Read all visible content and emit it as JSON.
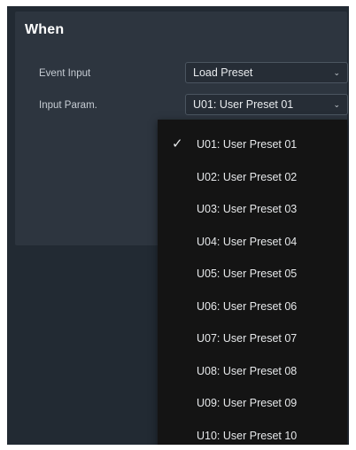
{
  "panel": {
    "title": "When"
  },
  "rows": [
    {
      "label": "Event Input",
      "value": "Load Preset"
    },
    {
      "label": "Input Param.",
      "value": "U01: User Preset 01"
    }
  ],
  "chevron_icon": "chevron-down",
  "dropdown": {
    "selected_index": 0,
    "check_icon": "checkmark",
    "items": [
      "U01: User Preset 01",
      "U02: User Preset 02",
      "U03: User Preset 03",
      "U04: User Preset 04",
      "U05: User Preset 05",
      "U06: User Preset 06",
      "U07: User Preset 07",
      "U08: User Preset 08",
      "U09: User Preset 09",
      "U10: User Preset 10"
    ]
  }
}
